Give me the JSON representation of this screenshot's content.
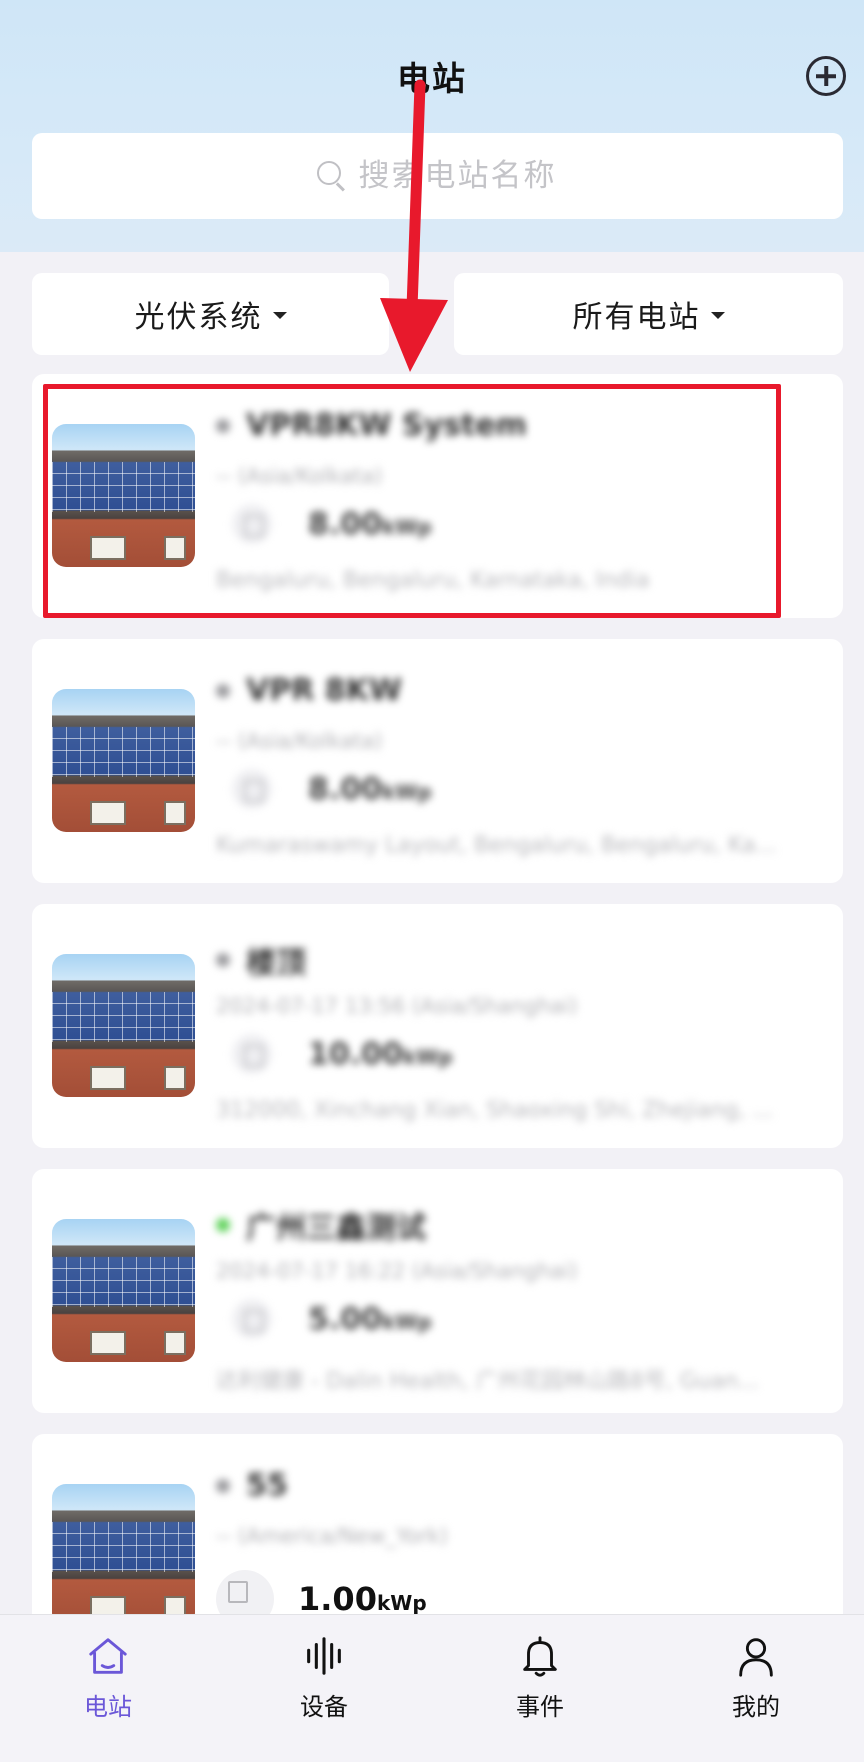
{
  "header": {
    "title": "电站"
  },
  "search": {
    "placeholder": "搜索电站名称"
  },
  "filters": {
    "system": "光伏系统",
    "scope": "所有电站"
  },
  "stations": [
    {
      "name": "VPR8KW System",
      "status": "offline",
      "timezone": "-- (Asia/Kolkata)",
      "capacity": "8.00",
      "unit": "kWp",
      "address": "Bengaluru, Bengaluru, Karnataka, India"
    },
    {
      "name": "VPR 8KW",
      "status": "offline",
      "timezone": "-- (Asia/Kolkata)",
      "capacity": "8.00",
      "unit": "kWp",
      "address": "Kumaraswamy Layout, Bengaluru, Bengaluru, Ka..."
    },
    {
      "name": "楼顶",
      "status": "offline",
      "timezone": "2024-07-17 13:56 (Asia/Shanghai)",
      "capacity": "10.00",
      "unit": "kWp",
      "address": "312000, Xinchang Xian, Shaoxing Shi, Zhejiang, ..."
    },
    {
      "name": "广州三鑫测试",
      "status": "online",
      "timezone": "2024-07-17 16:22 (Asia/Shanghai)",
      "capacity": "5.00",
      "unit": "kWp",
      "address": "达利健康 - Dalin Health, 广州花园林山路8号, Guan..."
    },
    {
      "name": "55",
      "status": "offline",
      "timezone": "-- (America/New_York)",
      "capacity": "1.00",
      "unit": "kWp",
      "address": ""
    }
  ],
  "tabbar": {
    "items": [
      {
        "label": "电站",
        "icon": "home-icon"
      },
      {
        "label": "设备",
        "icon": "waveform-icon"
      },
      {
        "label": "事件",
        "icon": "bell-icon"
      },
      {
        "label": "我的",
        "icon": "user-icon"
      }
    ]
  },
  "colors": {
    "accent": "#6b57d8",
    "highlight": "#e8192c",
    "online": "#5fd25a"
  }
}
